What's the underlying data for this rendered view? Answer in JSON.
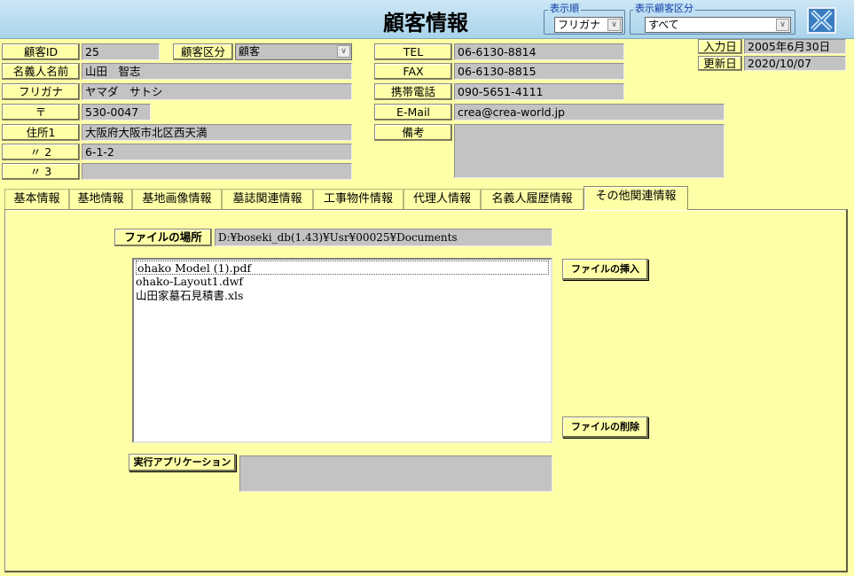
{
  "header": {
    "title": "顧客情報",
    "sort_group": {
      "label": "表示順",
      "value": "フリガナ"
    },
    "category_group": {
      "label": "表示顧客区分",
      "value": "すべて"
    }
  },
  "customer": {
    "id_label": "顧客ID",
    "id_value": "25",
    "kubun_label": "顧客区分",
    "kubun_value": "顧客",
    "name_label": "名義人名前",
    "name_value": "山田　智志",
    "furigana_label": "フリガナ",
    "furigana_value": "ヤマダ　サトシ",
    "zip_label": "〒",
    "zip_value": "530-0047",
    "addr1_label": "住所1",
    "addr1_value": "大阪府大阪市北区西天満",
    "addr2_label": "〃 2",
    "addr2_value": "6-1-2",
    "addr3_label": "〃 3",
    "addr3_value": "",
    "tel_label": "TEL",
    "tel_value": "06-6130-8814",
    "fax_label": "FAX",
    "fax_value": "06-6130-8815",
    "mobile_label": "携帯電話",
    "mobile_value": "090-5651-4111",
    "email_label": "E-Mail",
    "email_value": "crea@crea-world.jp",
    "memo_label": "備考",
    "memo_value": "",
    "entry_date_label": "入力日",
    "entry_date_value": "2005年6月30日",
    "update_date_label": "更新日",
    "update_date_value": "2020/10/07"
  },
  "tabs": [
    {
      "label": "基本情報"
    },
    {
      "label": "基地情報"
    },
    {
      "label": "基地画像情報"
    },
    {
      "label": "墓誌関連情報"
    },
    {
      "label": "工事物件情報"
    },
    {
      "label": "代理人情報"
    },
    {
      "label": "名義人履歴情報"
    },
    {
      "label": "その他関連情報"
    }
  ],
  "files": {
    "location_label": "ファイルの場所",
    "location_value": "D:¥boseki_db(1.43)¥Usr¥00025¥Documents",
    "items": [
      "ohako Model (1).pdf",
      "ohako-Layout1.dwf",
      "山田家墓石見積書.xls"
    ],
    "insert_button": "ファイルの挿入",
    "delete_button": "ファイルの削除",
    "app_label": "実行アプリケーション",
    "app_value": ""
  },
  "colors": {
    "background": "#ffffa8",
    "field": "#c3c3c3",
    "header": "#bcdff2",
    "close_icon": "#3b7cc0"
  }
}
